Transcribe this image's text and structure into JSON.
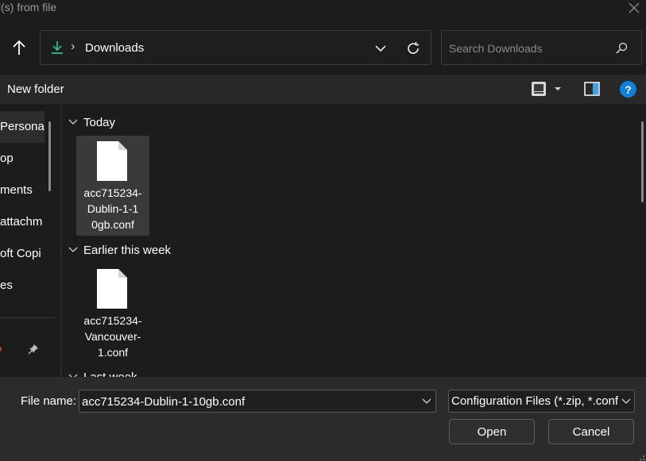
{
  "window": {
    "title": "l(s) from file"
  },
  "address": {
    "location": "Downloads"
  },
  "search": {
    "placeholder": "Search Downloads"
  },
  "command_bar": {
    "new_folder": "New folder",
    "help": "?"
  },
  "nav": {
    "items": [
      {
        "label": "Persona"
      },
      {
        "label": "op"
      },
      {
        "label": "ments"
      },
      {
        "label": "attachm"
      },
      {
        "label": "oft Copi"
      },
      {
        "label": "es"
      }
    ]
  },
  "groups": [
    {
      "label": "Today",
      "files": [
        {
          "name": "acc715234-Dublin-1-10gb.conf",
          "lines": [
            "acc715234-",
            "Dublin-1-1",
            "0gb.conf"
          ]
        }
      ]
    },
    {
      "label": "Earlier this week",
      "files": [
        {
          "name": "acc715234-Vancouver-1.conf",
          "lines": [
            "acc715234-",
            "Vancouver-",
            "1.conf"
          ]
        }
      ]
    },
    {
      "label": "Last week"
    }
  ],
  "footer": {
    "file_name_label": "File name:",
    "file_name_value": "acc715234-Dublin-1-10gb.conf",
    "filter": "Configuration Files (*.zip, *.conf",
    "open": "Open",
    "cancel": "Cancel"
  },
  "colors": {
    "accent": "#0f7fd8",
    "download_arrow": "#29c08d",
    "selection": "#3a3a3a"
  }
}
